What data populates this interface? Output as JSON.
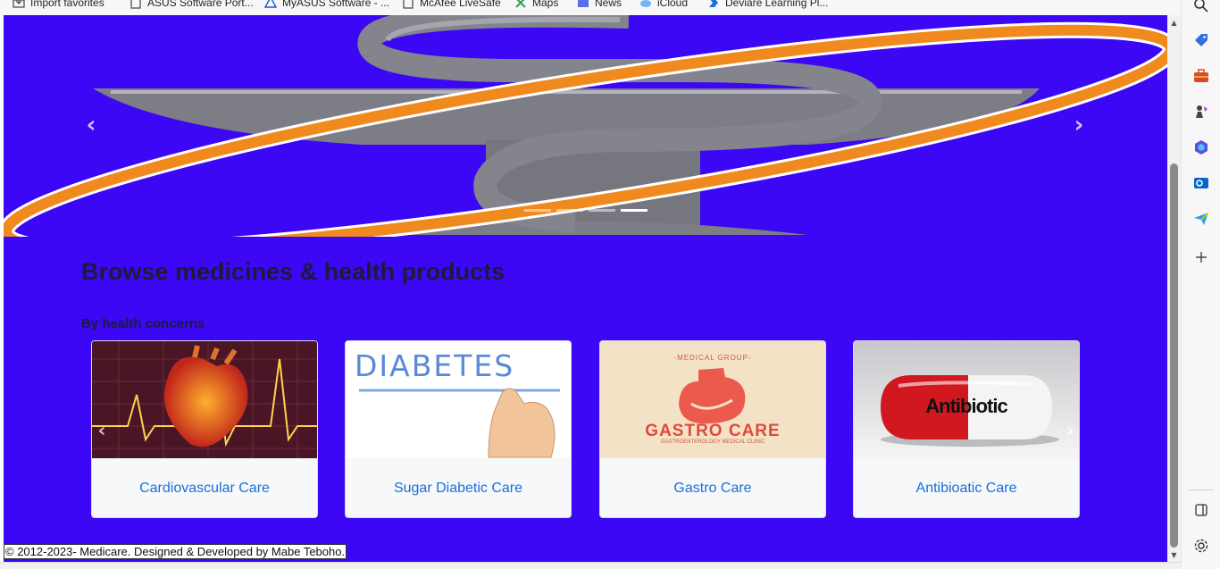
{
  "favorites_bar": {
    "items": [
      {
        "label": "Import favorites",
        "icon": "import-icon"
      },
      {
        "label": "ASUS Software Port...",
        "icon": "page-icon"
      },
      {
        "label": "MyASUS Software - ...",
        "icon": "asus-icon"
      },
      {
        "label": "McAfee LiveSafe",
        "icon": "page-icon"
      },
      {
        "label": "Maps",
        "icon": "maps-icon"
      },
      {
        "label": "News",
        "icon": "news-icon"
      },
      {
        "label": "iCloud",
        "icon": "cloud-icon"
      },
      {
        "label": "Deviare Learning Pl...",
        "icon": "deviare-icon"
      }
    ]
  },
  "hero": {
    "prev_icon": "‹",
    "next_icon": "›",
    "slide_count": 4,
    "active_slide": 4
  },
  "main": {
    "title": "Browse medicines & health products",
    "subtitle": "By health concerns"
  },
  "cards": [
    {
      "label": "Cardiovascular Care"
    },
    {
      "label": "Sugar Diabetic Care",
      "image_text": "DIABETES"
    },
    {
      "label": "Gastro Care",
      "image_text": "GASTRO CARE",
      "image_top_text": "-MEDICAL GROUP-",
      "image_sub_text": "GASTROENTEROLOGY MEDICAL CLINIC"
    },
    {
      "label": "Antibioatic Care",
      "image_text": "Antibiotic"
    }
  ],
  "footer": {
    "text": "© 2012-2023- Medicare. Designed & Developed by Mabe Teboho."
  },
  "colors": {
    "page_background": "#3b07f5",
    "card_label": "#1a6fd8",
    "heading": "#1e1a3a"
  },
  "edge_sidebar": {
    "items": [
      "search-icon",
      "tag-icon",
      "briefcase-icon",
      "chess-icon",
      "copilot-icon",
      "outlook-icon",
      "send-icon",
      "add-icon"
    ],
    "bottom": [
      "split-screen-icon",
      "settings-icon"
    ]
  }
}
